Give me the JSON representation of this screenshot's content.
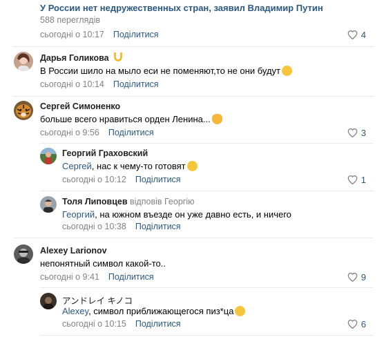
{
  "post": {
    "title": "У России нет недружественных стран, заявил Владимир Путин",
    "views": "588 переглядів",
    "time": "сьогодні о 10:17",
    "share": "Поділитися",
    "likes": "4"
  },
  "comments": [
    {
      "author": "Дарья Голикова",
      "text": "В России шило на мыло еси не поменяют,то не они будут",
      "time": "сьогодні о 10:14",
      "share": "Поділитися",
      "badge_icon": "horseshoe-icon",
      "emoji": "laughing-tears-emoji"
    },
    {
      "author": "Сергей Симоненко",
      "text": "больше всего нравиться орден Ленина...",
      "time": "сьогодні о 9:56",
      "share": "Поділитися",
      "likes": "3",
      "emoji": "ok-hand-emoji",
      "replies": [
        {
          "author": "Георгий Граховский",
          "mention": "Сергей",
          "text": ", нас к чему-то готовят",
          "time": "сьогодні о 10:12",
          "share": "Поділитися",
          "likes": "1",
          "emoji": "grinning-emoji"
        },
        {
          "author": "Толя Липовцев",
          "reply_to": "відповів Георгію",
          "mention": "Георгий",
          "text": ", на южном въезде он уже давно есть, и ничего",
          "time": "сьогодні о 10:38",
          "share": "Поділитися"
        }
      ]
    },
    {
      "author": "Alexey Larionov",
      "text": "непонятный символ какой-то..",
      "time": "сьогодні о 9:41",
      "share": "Поділитися",
      "likes": "9",
      "replies": [
        {
          "author": "アンドレイ キノコ",
          "mention": "Alexey",
          "text": ", символ приближающегося пиз*ца",
          "time": "сьогодні о 10:15",
          "share": "Поділитися",
          "likes": "6",
          "emoji": "rofl-emoji"
        }
      ]
    }
  ],
  "colors": {
    "link": "#2a5885",
    "meta": "#828282",
    "divider": "#e7e8ec"
  }
}
